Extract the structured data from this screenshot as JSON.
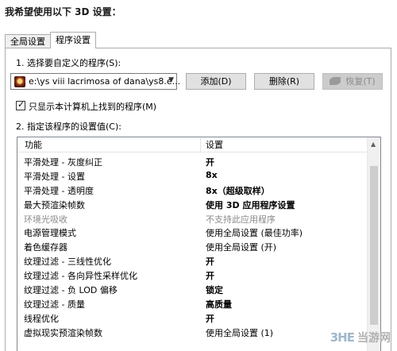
{
  "header": {
    "title": "我希望使用以下 3D 设置："
  },
  "tabs": [
    {
      "label": "全局设置",
      "active": false
    },
    {
      "label": "程序设置",
      "active": true
    }
  ],
  "program_section": {
    "label": "1. 选择要自定义的程序(S):",
    "selected_program": "e:\\ys viii lacrimosa of dana\\ys8.e...",
    "add_label": "添加(D)",
    "delete_label": "删除(R)",
    "restore_label": "恢复(T)"
  },
  "filter": {
    "label": "只显示本计算机上找到的程序(M)",
    "checked": true
  },
  "settings_section": {
    "label": "2. 指定该程序的设置值(C):",
    "columns": [
      "功能",
      "设置"
    ],
    "rows": [
      {
        "feature": "平滑处理 - 灰度纠正",
        "value": "开",
        "bold": true,
        "disabled": false
      },
      {
        "feature": "平滑处理 - 设置",
        "value": "8x",
        "bold": true,
        "disabled": false
      },
      {
        "feature": "平滑处理 - 透明度",
        "value": "8x（超级取样）",
        "bold": true,
        "disabled": false
      },
      {
        "feature": "最大预渲染帧数",
        "value": "使用 3D 应用程序设置",
        "bold": true,
        "disabled": false
      },
      {
        "feature": "环境光吸收",
        "value": "不支持此应用程序",
        "bold": false,
        "disabled": true
      },
      {
        "feature": "电源管理模式",
        "value": "使用全局设置 (最佳功率)",
        "bold": false,
        "disabled": false
      },
      {
        "feature": "着色缓存器",
        "value": "使用全局设置 (开)",
        "bold": false,
        "disabled": false
      },
      {
        "feature": "纹理过滤 - 三线性优化",
        "value": "开",
        "bold": true,
        "disabled": false
      },
      {
        "feature": "纹理过滤 - 各向异性采样优化",
        "value": "开",
        "bold": true,
        "disabled": false
      },
      {
        "feature": "纹理过滤 - 负 LOD 偏移",
        "value": "锁定",
        "bold": true,
        "disabled": false
      },
      {
        "feature": "纹理过滤 - 质量",
        "value": "高质量",
        "bold": true,
        "disabled": false
      },
      {
        "feature": "线程优化",
        "value": "开",
        "bold": true,
        "disabled": false
      },
      {
        "feature": "虚拟现实预渲染帧数",
        "value": "使用全局设置 (1)",
        "bold": false,
        "disabled": false
      }
    ]
  },
  "watermark": {
    "logo": "3HE",
    "text": "当游网"
  },
  "colors": {
    "window_bg": "#ffffff",
    "border": "#adadad",
    "button_bg": "#e1e1e1",
    "disabled_text": "#8a8a8a"
  }
}
